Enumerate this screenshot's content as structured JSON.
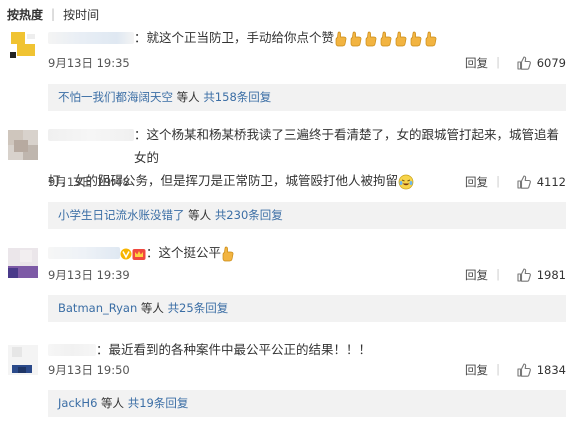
{
  "tabs": {
    "hot": "按热度",
    "time": "按时间"
  },
  "comments": [
    {
      "text": "：就这个正当防卫，手动给你点个赞",
      "thumb_count": 7,
      "time": "9月13日 19:35",
      "reply": "回复",
      "likes": "6079",
      "sub": {
        "user": "不怕一我们都海阔天空",
        "middle": " 等人 ",
        "count": "共158条回复"
      }
    },
    {
      "line1": "：这个杨某和杨某桥我读了三遍终于看清楚了，女的跟城管打起来，城管追着女的",
      "line2": "打，女的阻碍公务，但是挥刀是正常防卫，城管殴打他人被拘留",
      "time": "9月13日 19:48",
      "reply": "回复",
      "likes": "4112",
      "sub": {
        "user": "小学生日记流水账没错了",
        "middle": " 等人 ",
        "count": "共230条回复"
      }
    },
    {
      "text": "：这个挺公平",
      "time": "9月13日 19:39",
      "reply": "回复",
      "likes": "1981",
      "sub": {
        "user": "Batman_Ryan",
        "middle": " 等人 ",
        "count": "共25条回复"
      }
    },
    {
      "text": "：最近看到的各种案件中最公平公正的结果！！！",
      "time": "9月13日 19:50",
      "reply": "回复",
      "likes": "1834",
      "sub": {
        "user": "JackH6",
        "middle": " 等人 ",
        "count": "共19条回复"
      }
    }
  ],
  "colors": {
    "link": "#3b6ea5",
    "sub_bg": "#f2f2f2",
    "thumb": "#f2b441"
  },
  "icons": [
    "thumbs-up-icon",
    "okay-hand-emoji",
    "tears-of-joy-emoji",
    "v-badge-icon"
  ]
}
